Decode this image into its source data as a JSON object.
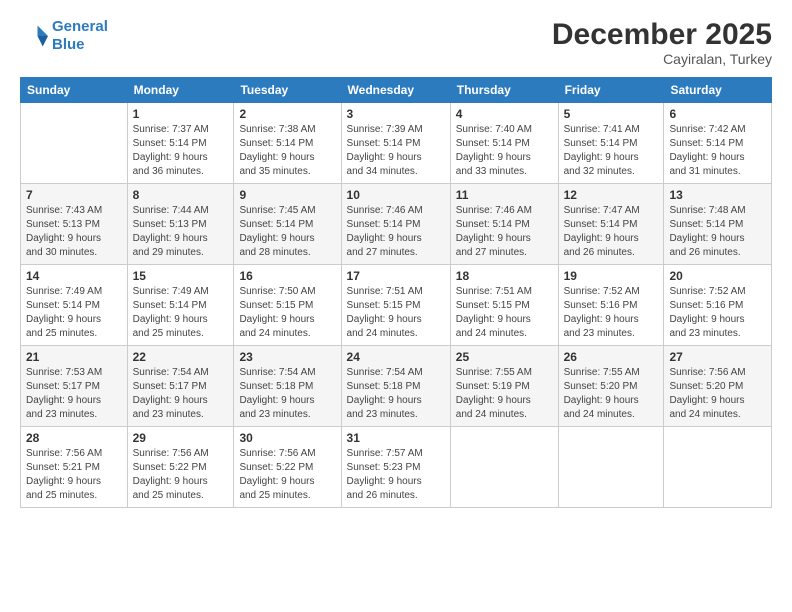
{
  "header": {
    "logo_line1": "General",
    "logo_line2": "Blue",
    "month": "December 2025",
    "location": "Cayiralan, Turkey"
  },
  "days_of_week": [
    "Sunday",
    "Monday",
    "Tuesday",
    "Wednesday",
    "Thursday",
    "Friday",
    "Saturday"
  ],
  "weeks": [
    [
      {
        "day": "",
        "info": ""
      },
      {
        "day": "1",
        "info": "Sunrise: 7:37 AM\nSunset: 5:14 PM\nDaylight: 9 hours\nand 36 minutes."
      },
      {
        "day": "2",
        "info": "Sunrise: 7:38 AM\nSunset: 5:14 PM\nDaylight: 9 hours\nand 35 minutes."
      },
      {
        "day": "3",
        "info": "Sunrise: 7:39 AM\nSunset: 5:14 PM\nDaylight: 9 hours\nand 34 minutes."
      },
      {
        "day": "4",
        "info": "Sunrise: 7:40 AM\nSunset: 5:14 PM\nDaylight: 9 hours\nand 33 minutes."
      },
      {
        "day": "5",
        "info": "Sunrise: 7:41 AM\nSunset: 5:14 PM\nDaylight: 9 hours\nand 32 minutes."
      },
      {
        "day": "6",
        "info": "Sunrise: 7:42 AM\nSunset: 5:14 PM\nDaylight: 9 hours\nand 31 minutes."
      }
    ],
    [
      {
        "day": "7",
        "info": "Sunrise: 7:43 AM\nSunset: 5:13 PM\nDaylight: 9 hours\nand 30 minutes."
      },
      {
        "day": "8",
        "info": "Sunrise: 7:44 AM\nSunset: 5:13 PM\nDaylight: 9 hours\nand 29 minutes."
      },
      {
        "day": "9",
        "info": "Sunrise: 7:45 AM\nSunset: 5:14 PM\nDaylight: 9 hours\nand 28 minutes."
      },
      {
        "day": "10",
        "info": "Sunrise: 7:46 AM\nSunset: 5:14 PM\nDaylight: 9 hours\nand 27 minutes."
      },
      {
        "day": "11",
        "info": "Sunrise: 7:46 AM\nSunset: 5:14 PM\nDaylight: 9 hours\nand 27 minutes."
      },
      {
        "day": "12",
        "info": "Sunrise: 7:47 AM\nSunset: 5:14 PM\nDaylight: 9 hours\nand 26 minutes."
      },
      {
        "day": "13",
        "info": "Sunrise: 7:48 AM\nSunset: 5:14 PM\nDaylight: 9 hours\nand 26 minutes."
      }
    ],
    [
      {
        "day": "14",
        "info": "Sunrise: 7:49 AM\nSunset: 5:14 PM\nDaylight: 9 hours\nand 25 minutes."
      },
      {
        "day": "15",
        "info": "Sunrise: 7:49 AM\nSunset: 5:14 PM\nDaylight: 9 hours\nand 25 minutes."
      },
      {
        "day": "16",
        "info": "Sunrise: 7:50 AM\nSunset: 5:15 PM\nDaylight: 9 hours\nand 24 minutes."
      },
      {
        "day": "17",
        "info": "Sunrise: 7:51 AM\nSunset: 5:15 PM\nDaylight: 9 hours\nand 24 minutes."
      },
      {
        "day": "18",
        "info": "Sunrise: 7:51 AM\nSunset: 5:15 PM\nDaylight: 9 hours\nand 24 minutes."
      },
      {
        "day": "19",
        "info": "Sunrise: 7:52 AM\nSunset: 5:16 PM\nDaylight: 9 hours\nand 23 minutes."
      },
      {
        "day": "20",
        "info": "Sunrise: 7:52 AM\nSunset: 5:16 PM\nDaylight: 9 hours\nand 23 minutes."
      }
    ],
    [
      {
        "day": "21",
        "info": "Sunrise: 7:53 AM\nSunset: 5:17 PM\nDaylight: 9 hours\nand 23 minutes."
      },
      {
        "day": "22",
        "info": "Sunrise: 7:54 AM\nSunset: 5:17 PM\nDaylight: 9 hours\nand 23 minutes."
      },
      {
        "day": "23",
        "info": "Sunrise: 7:54 AM\nSunset: 5:18 PM\nDaylight: 9 hours\nand 23 minutes."
      },
      {
        "day": "24",
        "info": "Sunrise: 7:54 AM\nSunset: 5:18 PM\nDaylight: 9 hours\nand 23 minutes."
      },
      {
        "day": "25",
        "info": "Sunrise: 7:55 AM\nSunset: 5:19 PM\nDaylight: 9 hours\nand 24 minutes."
      },
      {
        "day": "26",
        "info": "Sunrise: 7:55 AM\nSunset: 5:20 PM\nDaylight: 9 hours\nand 24 minutes."
      },
      {
        "day": "27",
        "info": "Sunrise: 7:56 AM\nSunset: 5:20 PM\nDaylight: 9 hours\nand 24 minutes."
      }
    ],
    [
      {
        "day": "28",
        "info": "Sunrise: 7:56 AM\nSunset: 5:21 PM\nDaylight: 9 hours\nand 25 minutes."
      },
      {
        "day": "29",
        "info": "Sunrise: 7:56 AM\nSunset: 5:22 PM\nDaylight: 9 hours\nand 25 minutes."
      },
      {
        "day": "30",
        "info": "Sunrise: 7:56 AM\nSunset: 5:22 PM\nDaylight: 9 hours\nand 25 minutes."
      },
      {
        "day": "31",
        "info": "Sunrise: 7:57 AM\nSunset: 5:23 PM\nDaylight: 9 hours\nand 26 minutes."
      },
      {
        "day": "",
        "info": ""
      },
      {
        "day": "",
        "info": ""
      },
      {
        "day": "",
        "info": ""
      }
    ]
  ]
}
